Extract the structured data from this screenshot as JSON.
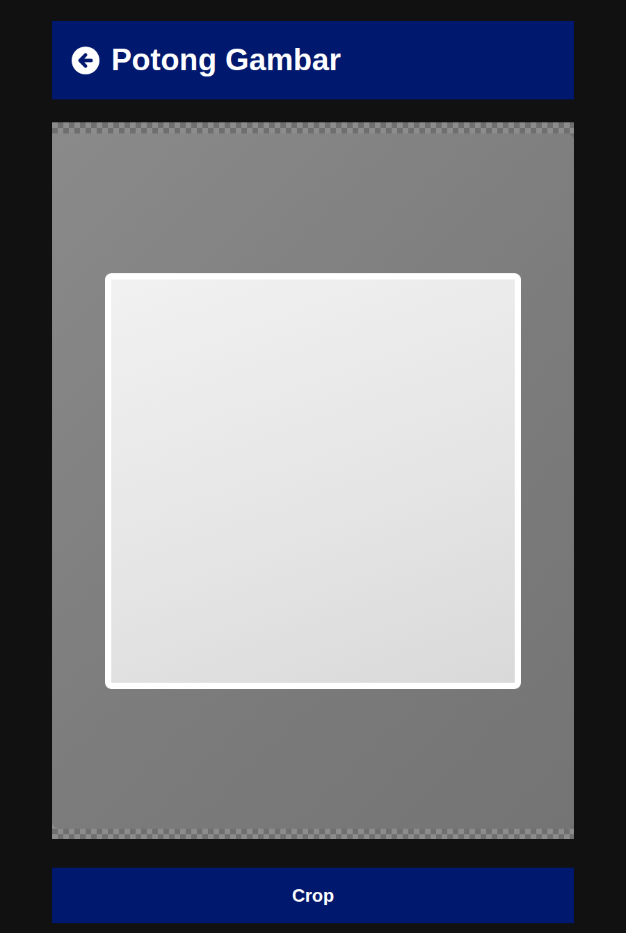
{
  "header": {
    "title": "Potong Gambar"
  },
  "buttons": [
    "Crop"
  ]
}
